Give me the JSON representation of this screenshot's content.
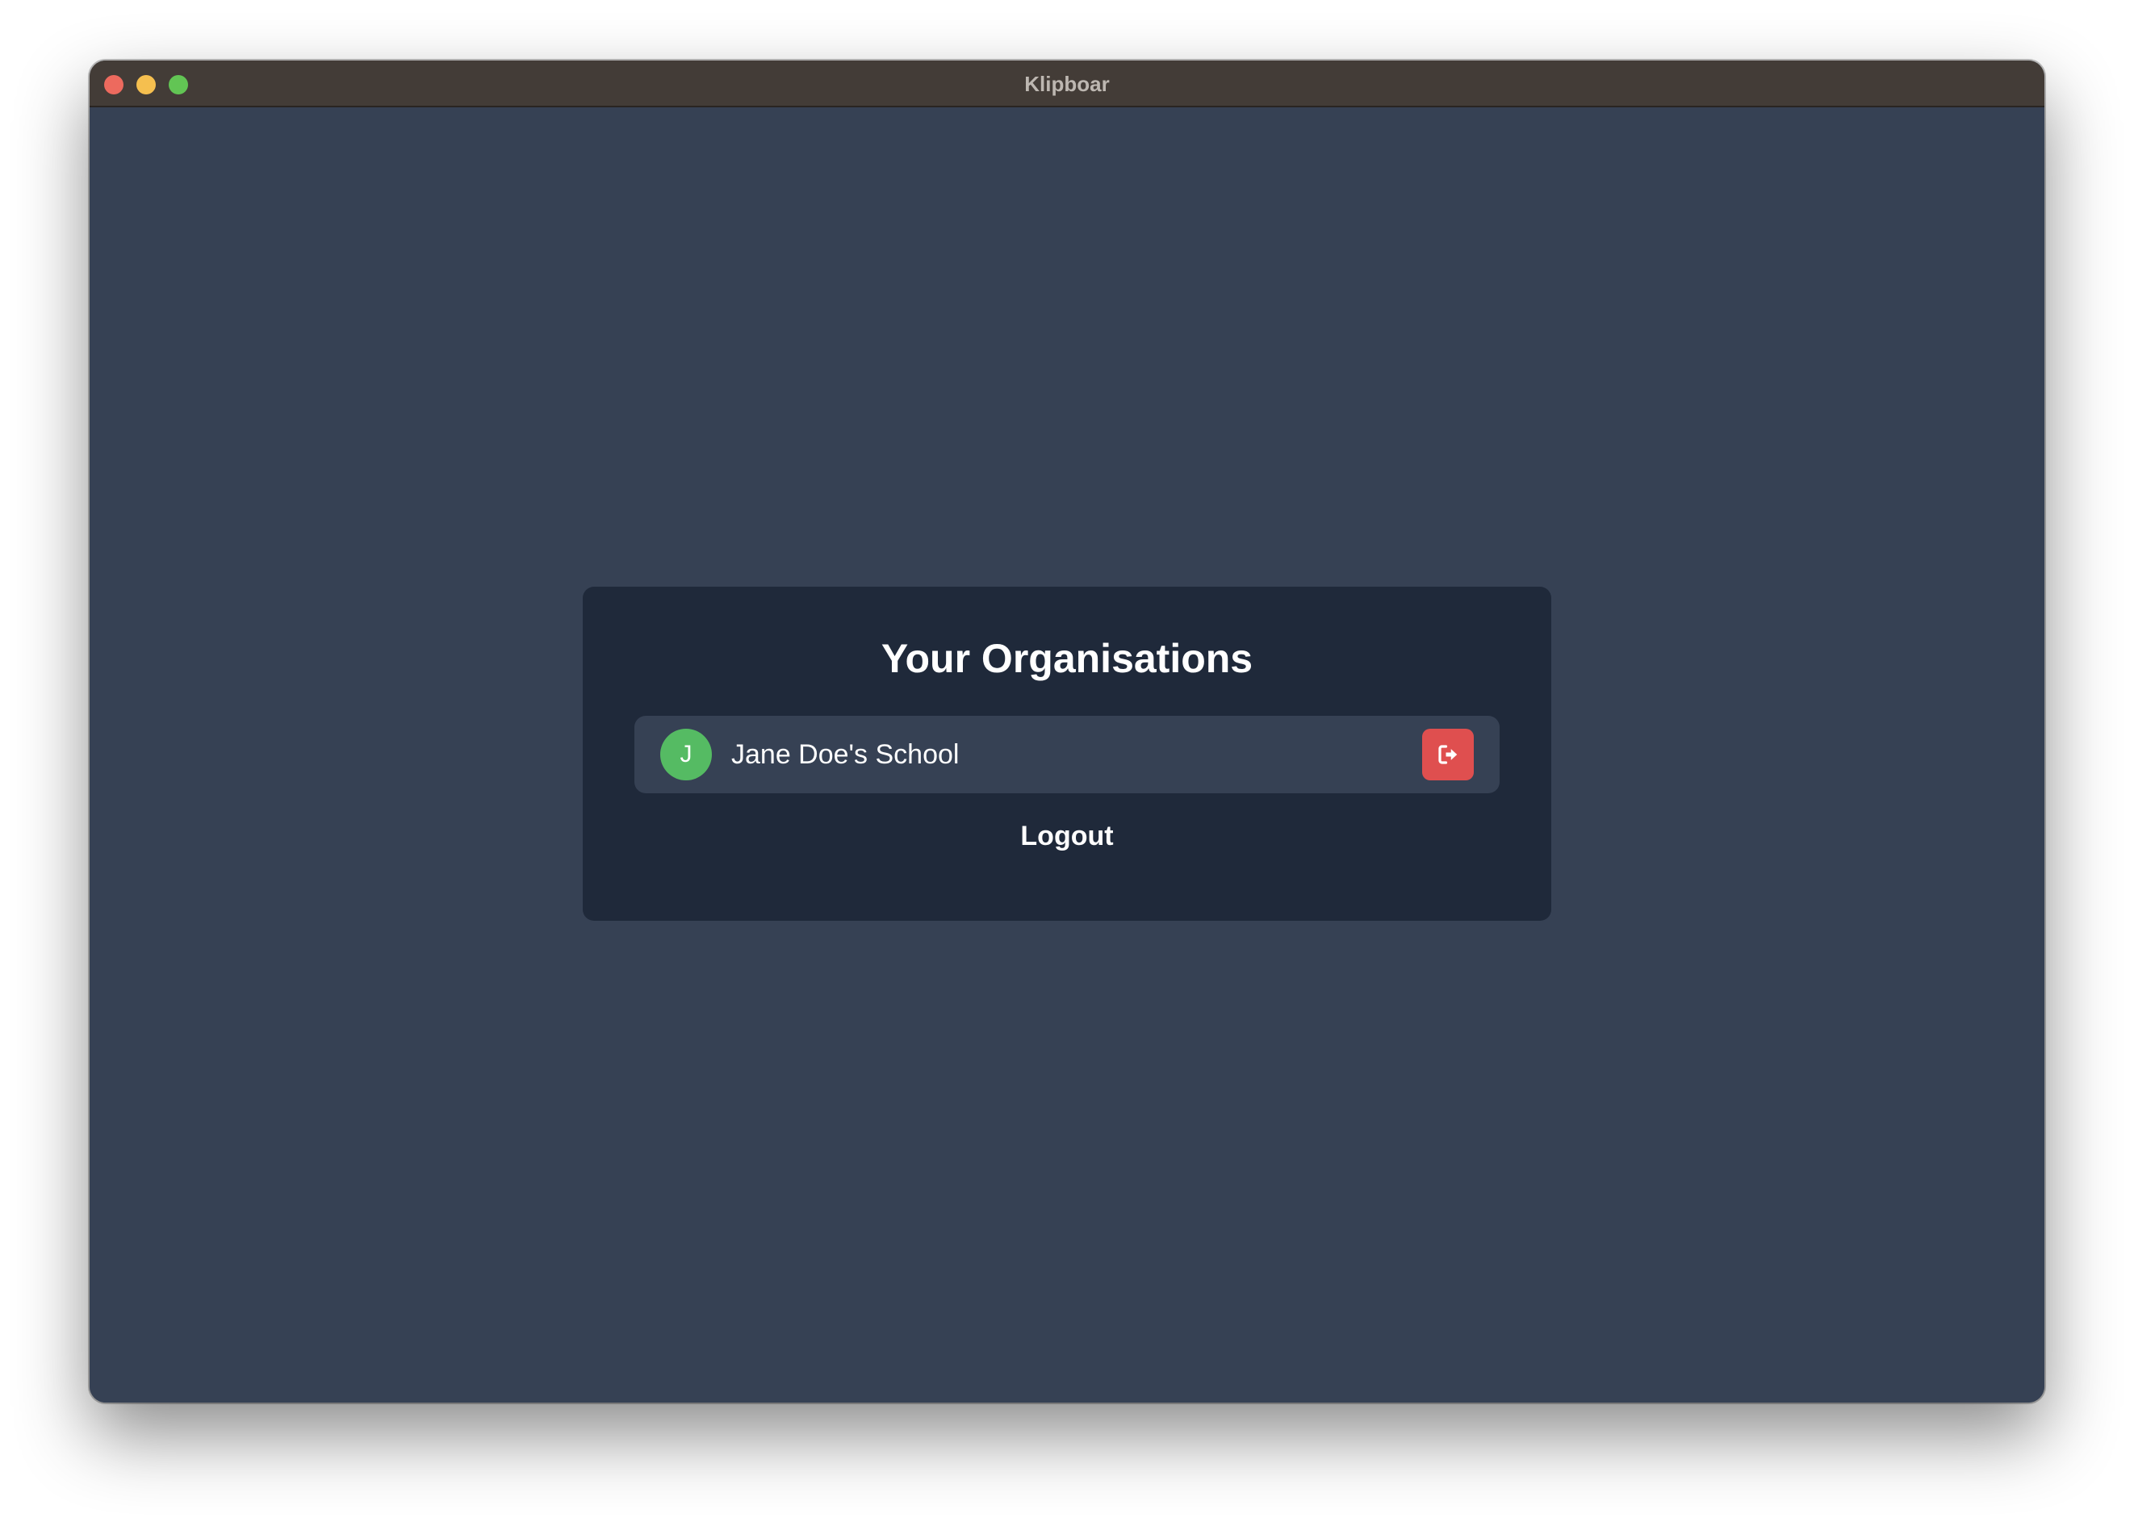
{
  "window": {
    "title": "Klipboar",
    "controls": [
      "close",
      "minimize",
      "maximize"
    ]
  },
  "card": {
    "title": "Your Organisations",
    "organisations": [
      {
        "initial": "J",
        "name": "Jane Doe's School",
        "avatar_color": "#55bb63",
        "action_icon": "leave-organisation-icon"
      }
    ],
    "logout_label": "Logout"
  },
  "colors": {
    "background": "#364154",
    "card": "#1f293a",
    "row": "#364154",
    "danger": "#df4f4f",
    "titlebar": "#433c37"
  }
}
